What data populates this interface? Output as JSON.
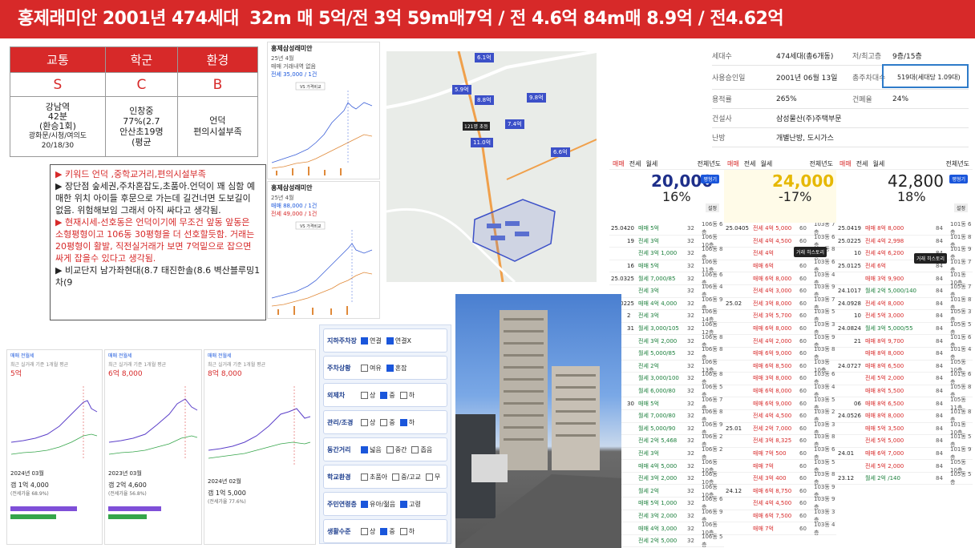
{
  "header": {
    "title_a": "홍제래미안 2001년 474세대",
    "title_b": "32m 매 5억/전 3억  59m매7억 / 전 4.6억 84m매 8.9억 / 전4.62억"
  },
  "score": {
    "headers": [
      "교통",
      "학군",
      "환경"
    ],
    "grades": [
      "S",
      "C",
      "B"
    ],
    "traffic": {
      "line1": "강남역",
      "line2": "42분",
      "line3": "(환승1회)",
      "line4": "광화문/시청/여의도",
      "line5": "20/18/30"
    },
    "school": {
      "line1": "인창중",
      "line2": "77%(2.7",
      "line3": "안산초19명",
      "line4": "(평균"
    },
    "env": {
      "line1": "언덕",
      "line2": "편의시설부족"
    }
  },
  "keywords": {
    "kw": "▶ 키워드 언덕 ,중학교거리,편의시설부족",
    "cons": "▶ 장단점 숲세권,주차혼잡도,초품아.언덕이 꽤 심함 예매한 위치 아이들 후문으로 가는데 길건너면 도보길이 없음. 위험해보임 그래서 아직 싸다고 생각됨.",
    "price": "▶ 현재시세-선호동은 언덕이기에 무조건 앞동 앞동은 소형평형이고 106동 30평형을 더 선호할듯함. 거래는 20평형이 활발, 직전실거래가 보면 7억밑으로 잡으면 싸게 잡을수 있다고 생각됨.",
    "compare": "▶ 비교단지 남가좌현대(8.7 태진한솔(8.6 벽산블루밍1차(9"
  },
  "chart1": {
    "title": "홍제삼성래미안",
    "sub": "25년 4월",
    "info": "매매 거래내역 없음",
    "rent": "전세 35,000 / 1건",
    "tag": "VS 가격비교"
  },
  "chart2": {
    "title": "홍제삼성래미안",
    "sub": "25년 4월",
    "info": "매매 88,000 / 1건",
    "rent": "전세 49,000 / 1건",
    "tag": "VS 가격비교"
  },
  "map": {
    "labels": [
      "6.1억",
      "5.9억",
      "8.8억",
      "9.8억",
      "7.4억",
      "11.0억",
      "6.6억",
      "121명 초등"
    ]
  },
  "info": {
    "rows": [
      {
        "k": "세대수",
        "v": "474세대(총6개동)",
        "k2": "저/최고층",
        "v2": "9층/15층"
      },
      {
        "k": "사용승인일",
        "v": "2001년 06월 13일",
        "k2": "총주차대수",
        "v2": "519대(세대당 1.09대)"
      },
      {
        "k": "용적률",
        "v": "265%",
        "k2": "건폐율",
        "v2": "24%"
      },
      {
        "k": "건설사",
        "v": "삼성물산(주)주택부문",
        "k2": "",
        "v2": ""
      },
      {
        "k": "난방",
        "v": "개별난방, 도시가스",
        "k2": "",
        "v2": ""
      }
    ]
  },
  "tx1": {
    "big": "20,000",
    "pct": "16%",
    "tabs": [
      "매매",
      "전세",
      "월세"
    ]
  },
  "tx2": {
    "big": "24,000",
    "pct": "-17%",
    "tabs": [
      "매매",
      "전세",
      "월세"
    ]
  },
  "tx3": {
    "big": "42,800",
    "pct": "18%",
    "tabs": [
      "매매",
      "전세",
      "월세"
    ]
  },
  "tx_rows1": [
    {
      "date": "25.04",
      "d": "20",
      "p": "매매 5억",
      "a": "32",
      "f": "106동 6층",
      "r": 0
    },
    {
      "date": "",
      "d": "19",
      "p": "전세 3억",
      "a": "32",
      "f": "106동 10층",
      "r": 0
    },
    {
      "date": "",
      "d": "",
      "p": "전세 3억 1,000",
      "a": "32",
      "f": "106동 8층",
      "r": 0
    },
    {
      "date": "",
      "d": "16",
      "p": "매매 5억",
      "a": "32",
      "f": "106동 11층",
      "r": 0
    },
    {
      "date": "25.03",
      "d": "25",
      "p": "월세 7,000/85",
      "a": "32",
      "f": "106동 6층",
      "r": 0
    },
    {
      "date": "",
      "d": "",
      "p": "전세 3억",
      "a": "32",
      "f": "106동 4층",
      "r": 0
    },
    {
      "date": "25.02",
      "d": "25",
      "p": "매매 4억 4,000",
      "a": "32",
      "f": "106동 9층",
      "r": 0
    },
    {
      "date": "",
      "d": "2",
      "p": "전세 3억",
      "a": "32",
      "f": "106동 14층",
      "r": 0
    },
    {
      "date": "",
      "d": "31",
      "p": "월세 3,000/105",
      "a": "32",
      "f": "106동 12층",
      "r": 0
    },
    {
      "date": "",
      "d": "",
      "p": "전세 3억 2,000",
      "a": "32",
      "f": "106동 8층",
      "r": 0
    },
    {
      "date": "",
      "d": "",
      "p": "월세 5,000/85",
      "a": "32",
      "f": "106동 8층",
      "r": 0
    },
    {
      "date": "",
      "d": "",
      "p": "전세 2억",
      "a": "32",
      "f": "106동 13층",
      "r": 0
    },
    {
      "date": "",
      "d": "",
      "p": "월세 3,000/100",
      "a": "32",
      "f": "106동 8층",
      "r": 0
    },
    {
      "date": "",
      "d": "",
      "p": "월세 6,000/80",
      "a": "32",
      "f": "106동 5층",
      "r": 0
    },
    {
      "date": "",
      "d": "30",
      "p": "매매 5억",
      "a": "32",
      "f": "106동 7층",
      "r": 0
    },
    {
      "date": "",
      "d": "",
      "p": "월세 7,000/80",
      "a": "32",
      "f": "106동 8층",
      "r": 0
    },
    {
      "date": "",
      "d": "",
      "p": "월세 5,000/90",
      "a": "32",
      "f": "106동 9층",
      "r": 0
    },
    {
      "date": "",
      "d": "",
      "p": "전세 2억 5,468",
      "a": "32",
      "f": "106동 2층",
      "r": 0
    },
    {
      "date": "",
      "d": "",
      "p": "전세 3억",
      "a": "32",
      "f": "106동 2층",
      "r": 0
    },
    {
      "date": "",
      "d": "",
      "p": "매매 4억 5,000",
      "a": "32",
      "f": "106동 10층",
      "r": 0
    },
    {
      "date": "",
      "d": "",
      "p": "전세 3억 2,000",
      "a": "32",
      "f": "106동 10층",
      "r": 0
    },
    {
      "date": "",
      "d": "",
      "p": "월세 2억",
      "a": "32",
      "f": "106동 10층",
      "r": 0
    },
    {
      "date": "",
      "d": "",
      "p": "매매 5억 1,000",
      "a": "32",
      "f": "106동 6층",
      "r": 0
    },
    {
      "date": "",
      "d": "",
      "p": "전세 3억 2,000",
      "a": "32",
      "f": "106동 9층",
      "r": 0
    },
    {
      "date": "",
      "d": "",
      "p": "매매 4억 3,000",
      "a": "32",
      "f": "106동 10층",
      "r": 0
    },
    {
      "date": "",
      "d": "",
      "p": "전세 2억 5,000",
      "a": "32",
      "f": "106동 5층",
      "r": 0
    }
  ],
  "tx_rows2": [
    {
      "date": "25.04",
      "d": "05",
      "p": "전세 4억 5,000",
      "a": "60",
      "f": "103동 7층",
      "r": 1
    },
    {
      "date": "",
      "d": "",
      "p": "전세 4억 4,500",
      "a": "60",
      "f": "103동 6층",
      "r": 1
    },
    {
      "date": "",
      "d": "",
      "p": "전세 4억",
      "a": "60",
      "f": "103동 8층",
      "r": 1
    },
    {
      "date": "",
      "d": "",
      "p": "매매 6억",
      "a": "60",
      "f": "103동 6층",
      "r": 1
    },
    {
      "date": "",
      "d": "",
      "p": "매매 6억 8,000",
      "a": "60",
      "f": "103동 4층",
      "r": 1
    },
    {
      "date": "",
      "d": "",
      "p": "전세 4억 3,000",
      "a": "60",
      "f": "103동 9층",
      "r": 1
    },
    {
      "date": "25.02",
      "d": "",
      "p": "전세 3억 8,000",
      "a": "60",
      "f": "103동 7층",
      "r": 1
    },
    {
      "date": "",
      "d": "",
      "p": "전세 3억 5,700",
      "a": "60",
      "f": "103동 5층",
      "r": 1
    },
    {
      "date": "",
      "d": "",
      "p": "매매 6억 8,000",
      "a": "60",
      "f": "103동 3층",
      "r": 1
    },
    {
      "date": "",
      "d": "",
      "p": "전세 4억 2,000",
      "a": "60",
      "f": "103동 9층",
      "r": 1
    },
    {
      "date": "",
      "d": "",
      "p": "매매 6억 9,000",
      "a": "60",
      "f": "103동 8층",
      "r": 1
    },
    {
      "date": "",
      "d": "",
      "p": "매매 6억 8,500",
      "a": "60",
      "f": "103동 10층",
      "r": 1
    },
    {
      "date": "",
      "d": "",
      "p": "매매 3억 8,000",
      "a": "60",
      "f": "103동 6층",
      "r": 1
    },
    {
      "date": "",
      "d": "",
      "p": "매매 6억 8,000",
      "a": "60",
      "f": "103동 4층",
      "r": 1
    },
    {
      "date": "",
      "d": "",
      "p": "매매 6억 9,000",
      "a": "60",
      "f": "103동 5층",
      "r": 1
    },
    {
      "date": "",
      "d": "",
      "p": "전세 4억 4,500",
      "a": "60",
      "f": "103동 2층",
      "r": 1
    },
    {
      "date": "25.01",
      "d": "",
      "p": "전세 2억 7,000",
      "a": "60",
      "f": "103동 3층",
      "r": 1
    },
    {
      "date": "",
      "d": "",
      "p": "전세 3억 8,325",
      "a": "60",
      "f": "103동 8층",
      "r": 1
    },
    {
      "date": "",
      "d": "",
      "p": "매매 7억 500",
      "a": "60",
      "f": "103동 6층",
      "r": 1
    },
    {
      "date": "",
      "d": "",
      "p": "매매 7억",
      "a": "60",
      "f": "103동 5층",
      "r": 1
    },
    {
      "date": "",
      "d": "",
      "p": "전세 3억 400",
      "a": "60",
      "f": "103동 8층",
      "r": 1
    },
    {
      "date": "24.12",
      "d": "",
      "p": "매매 6억 8,750",
      "a": "60",
      "f": "103동 9층",
      "r": 1
    },
    {
      "date": "",
      "d": "",
      "p": "전세 4억 4,500",
      "a": "60",
      "f": "103동 9층",
      "r": 1
    },
    {
      "date": "",
      "d": "",
      "p": "매매 6억 7,500",
      "a": "60",
      "f": "103동 3층",
      "r": 1
    },
    {
      "date": "",
      "d": "",
      "p": "매매 7억",
      "a": "60",
      "f": "103동 4층",
      "r": 1
    }
  ],
  "tx_rows3": [
    {
      "date": "25.04",
      "d": "19",
      "p": "매매 8억 8,000",
      "a": "84",
      "f": "101동 6층",
      "r": 1
    },
    {
      "date": "25.02",
      "d": "25",
      "p": "전세 4억 2,998",
      "a": "84",
      "f": "101동 8층",
      "r": 1
    },
    {
      "date": "",
      "d": "10",
      "p": "전세 4억 6,200",
      "a": "84",
      "f": "101동 9층",
      "r": 1
    },
    {
      "date": "25.01",
      "d": "25",
      "p": "전세 6억",
      "a": "84",
      "f": "101동 7층",
      "r": 1
    },
    {
      "date": "",
      "d": "",
      "p": "매매 3억 9,900",
      "a": "84",
      "f": "101동 10층",
      "r": 1
    },
    {
      "date": "24.10",
      "d": "17",
      "p": "월세 2억 5,000/140",
      "a": "84",
      "f": "105동 7층",
      "r": 0
    },
    {
      "date": "24.09",
      "d": "28",
      "p": "전세 4억 8,000",
      "a": "84",
      "f": "101동 8층",
      "r": 1
    },
    {
      "date": "",
      "d": "10",
      "p": "전세 5억 3,000",
      "a": "84",
      "f": "105동 3층",
      "r": 1
    },
    {
      "date": "24.08",
      "d": "24",
      "p": "월세 3억 5,000/55",
      "a": "84",
      "f": "105동 5층",
      "r": 0
    },
    {
      "date": "",
      "d": "21",
      "p": "매매 8억 9,700",
      "a": "84",
      "f": "101동 6층",
      "r": 1
    },
    {
      "date": "",
      "d": "",
      "p": "매매 8억 8,000",
      "a": "84",
      "f": "101동 4층",
      "r": 1
    },
    {
      "date": "24.07",
      "d": "27",
      "p": "매매 8억 6,500",
      "a": "84",
      "f": "105동 10층",
      "r": 1
    },
    {
      "date": "",
      "d": "",
      "p": "전세 5억 2,000",
      "a": "84",
      "f": "101동 6층",
      "r": 1
    },
    {
      "date": "",
      "d": "",
      "p": "매매 8억 5,500",
      "a": "84",
      "f": "105동 8층",
      "r": 1
    },
    {
      "date": "",
      "d": "06",
      "p": "매매 8억 6,500",
      "a": "84",
      "f": "105동 11층",
      "r": 1
    },
    {
      "date": "24.05",
      "d": "26",
      "p": "매매 8억 8,000",
      "a": "84",
      "f": "101동 8층",
      "r": 1
    },
    {
      "date": "",
      "d": "",
      "p": "매매 5억 3,500",
      "a": "84",
      "f": "101동 10층",
      "r": 1
    },
    {
      "date": "",
      "d": "",
      "p": "전세 5억 5,000",
      "a": "84",
      "f": "101동 5층",
      "r": 1
    },
    {
      "date": "24.01",
      "d": "",
      "p": "매매 6억 7,000",
      "a": "84",
      "f": "101동 9층",
      "r": 1
    },
    {
      "date": "",
      "d": "",
      "p": "전세 5억 2,000",
      "a": "84",
      "f": "105동 10층",
      "r": 1
    },
    {
      "date": "23.12",
      "d": "",
      "p": "월세 2억 /140",
      "a": "84",
      "f": "105동 5층",
      "r": 0
    }
  ],
  "mini1": {
    "big": "5억",
    "sub": "최근 실거래 기준 1개월 평균",
    "date": "2024년 03월",
    "gap": "갭 1억 4,000",
    "ratio": "(전세가율 68.9%)"
  },
  "mini2": {
    "big": "6억 8,000",
    "sub": "최근 실거래 기준 1개월 평균",
    "date": "2023년 03월",
    "gap": "갭 2억 4,600",
    "ratio": "(전세가율 56.8%)"
  },
  "mini3": {
    "big": "8억 8,000",
    "sub": "최근 실거래 기준 1개월 평균",
    "date": "2024년 02월",
    "gap": "갭 1억 5,000",
    "ratio": "(전세가율 77.6%)"
  },
  "checklist": [
    {
      "label": "지하주차장",
      "opts": [
        {
          "t": "연결",
          "on": true
        },
        {
          "t": "연결X",
          "on": true
        }
      ]
    },
    {
      "label": "주차상황",
      "opts": [
        {
          "t": "여유",
          "on": false
        },
        {
          "t": "혼잡",
          "on": true
        }
      ]
    },
    {
      "label": "외제차",
      "opts": [
        {
          "t": "상",
          "on": false
        },
        {
          "t": "중",
          "on": true
        },
        {
          "t": "하",
          "on": false
        }
      ]
    },
    {
      "label": "관리/조경",
      "opts": [
        {
          "t": "상",
          "on": false
        },
        {
          "t": "중",
          "on": false
        },
        {
          "t": "하",
          "on": true
        }
      ]
    },
    {
      "label": "동간거리",
      "opts": [
        {
          "t": "넓음",
          "on": true
        },
        {
          "t": "중간",
          "on": false
        },
        {
          "t": "좁음",
          "on": false
        }
      ]
    },
    {
      "label": "학교환경",
      "opts": [
        {
          "t": "초품아",
          "on": false
        },
        {
          "t": "중/고교",
          "on": false
        },
        {
          "t": "무",
          "on": false
        }
      ]
    },
    {
      "label": "주민연령층",
      "opts": [
        {
          "t": "유아/젊음",
          "on": true
        },
        {
          "t": "고령",
          "on": true
        }
      ]
    },
    {
      "label": "생활수준",
      "opts": [
        {
          "t": "상",
          "on": false
        },
        {
          "t": "중",
          "on": true
        },
        {
          "t": "하",
          "on": false
        }
      ]
    }
  ],
  "ui": {
    "tooltip": "거래 히스토리",
    "btn": "평형기",
    "set": "설정",
    "total": "전체년도"
  }
}
